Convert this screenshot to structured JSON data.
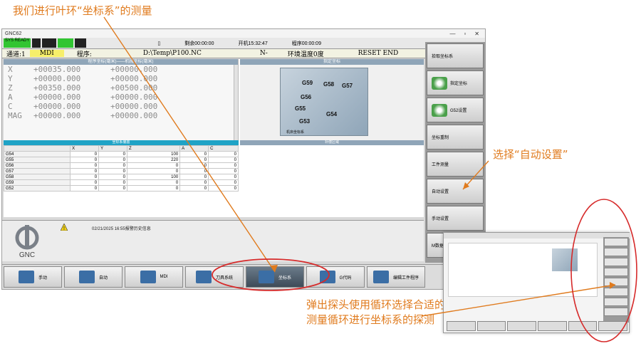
{
  "annotations": {
    "top": "我们进行叶环“坐标系”的测量",
    "right": "选择“自动设置”",
    "bottom": "弹出探头使用循环选择合适的测量循环进行坐标系的探测"
  },
  "window": {
    "title": "GNC62"
  },
  "statusbar": {
    "badges": [
      "SYS READY",
      "",
      "",
      "",
      ""
    ],
    "remaining": "剩余00:00:00",
    "boot": "开机15:32:47",
    "program_time": "程序00:00:09"
  },
  "infobar": {
    "channel": "通道:1",
    "mode": "MDI",
    "program_label": "程序:",
    "program_path": "D:\\Temp\\P100.NC",
    "n_value": "N-",
    "ambient": "环境温度0度",
    "reset": "RESET END"
  },
  "coords": {
    "header": "程序坐标(毫米)——机械坐标(毫米)",
    "rows": [
      {
        "axis": "X",
        "a": "+00035.000",
        "b": "+00000.000"
      },
      {
        "axis": "Y",
        "a": "+00000.000",
        "b": "+00000.000"
      },
      {
        "axis": "Z",
        "a": "+00350.000",
        "b": "+00500.000"
      },
      {
        "axis": "A",
        "a": "+00000.000",
        "b": "+00000.000"
      },
      {
        "axis": "C",
        "a": "+00000.000",
        "b": "+00000.000"
      },
      {
        "axis": "MAG",
        "a": "+00000.000",
        "b": "+00000.000"
      }
    ]
  },
  "diagram": {
    "header": "指定坐标",
    "labels": [
      "G59",
      "G58",
      "G57",
      "G56",
      "G55",
      "G54",
      "G53"
    ],
    "caption": "机床坐标系"
  },
  "offsets": {
    "header": "坐标系偏置",
    "columns": [
      "",
      "X",
      "Y",
      "Z",
      "A",
      "C"
    ],
    "rows": [
      [
        "G54",
        "0",
        "0",
        "100",
        "0",
        "0"
      ],
      [
        "G55",
        "0",
        "0",
        "220",
        "0",
        "0"
      ],
      [
        "G56",
        "0",
        "0",
        "0",
        "0",
        "0"
      ],
      [
        "G57",
        "0",
        "0",
        "0",
        "0",
        "0"
      ],
      [
        "G58",
        "0",
        "0",
        "100",
        "0",
        "0"
      ],
      [
        "G59",
        "0",
        "0",
        "0",
        "0",
        "0"
      ],
      [
        "G52",
        "0",
        "0",
        "0",
        "0",
        "0"
      ]
    ]
  },
  "reserve": {
    "header": "补偿区域"
  },
  "alarm": {
    "text": "02/21/2025 16:55报警历史信息",
    "logo": "GNC"
  },
  "sidebar": {
    "items": [
      {
        "label": "拾取坐标系"
      },
      {
        "label": "指定坐标"
      },
      {
        "label": "G52设置"
      },
      {
        "label": "坐标重制"
      },
      {
        "label": "工件测量"
      },
      {
        "label": "自动设置"
      },
      {
        "label": "手动设置"
      },
      {
        "label": "M数据"
      }
    ]
  },
  "softkeys": [
    {
      "label": "手动"
    },
    {
      "label": "自动"
    },
    {
      "label": "MDI"
    },
    {
      "label": "刀具系统"
    },
    {
      "label": "坐标系"
    },
    {
      "label": "G代码"
    },
    {
      "label": "编辑工件程序"
    }
  ],
  "colors": {
    "annotation": "#e07b1e",
    "highlight_ring": "#d62a2a",
    "active_tab": "#1fa3c6"
  }
}
